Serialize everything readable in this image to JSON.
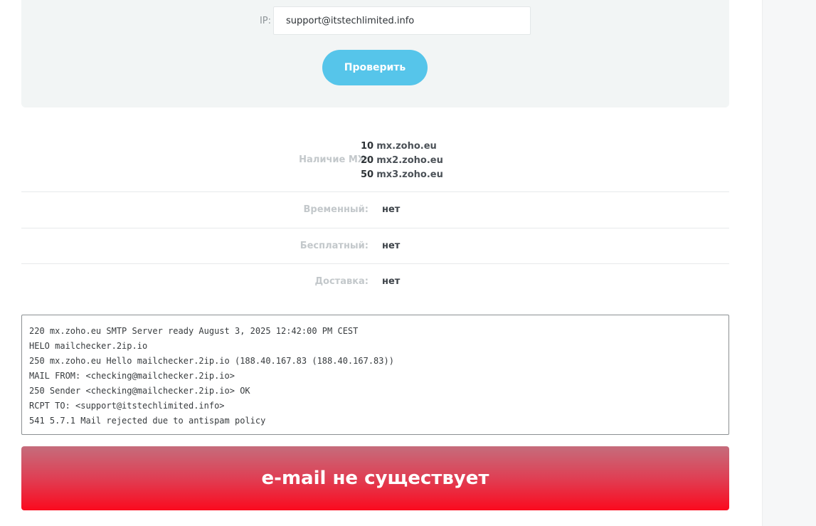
{
  "form": {
    "ip_label": "IP:",
    "ip_value": "support@itstechlimited.info",
    "check_button": "Проверить"
  },
  "results": {
    "mx": {
      "label": "Наличие MX:",
      "records": [
        {
          "preference": "10",
          "host": "mx.zoho.eu"
        },
        {
          "preference": "20",
          "host": "mx2.zoho.eu"
        },
        {
          "preference": "50",
          "host": "mx3.zoho.eu"
        }
      ]
    },
    "temporary": {
      "label": "Временный:",
      "value": "нет"
    },
    "free": {
      "label": "Бесплатный:",
      "value": "нет"
    },
    "delivery": {
      "label": "Доставка:",
      "value": "нет"
    }
  },
  "smtp_log": [
    "220 mx.zoho.eu SMTP Server ready August 3, 2025 12:42:00 PM CEST",
    "HELO mailchecker.2ip.io",
    "250 mx.zoho.eu Hello mailchecker.2ip.io (188.40.167.83 (188.40.167.83))",
    "MAIL FROM: <checking@mailchecker.2ip.io>",
    "250 Sender <checking@mailchecker.2ip.io> OK",
    "RCPT TO: <support@itstechlimited.info>",
    "541 5.7.1 Mail rejected due to antispam policy"
  ],
  "verdict": {
    "text": "e-mail не существует"
  },
  "colors": {
    "accent_button": "#56c5ea",
    "panel_background": "#f2f5f5",
    "verdict_red": "#fb0a1e"
  }
}
